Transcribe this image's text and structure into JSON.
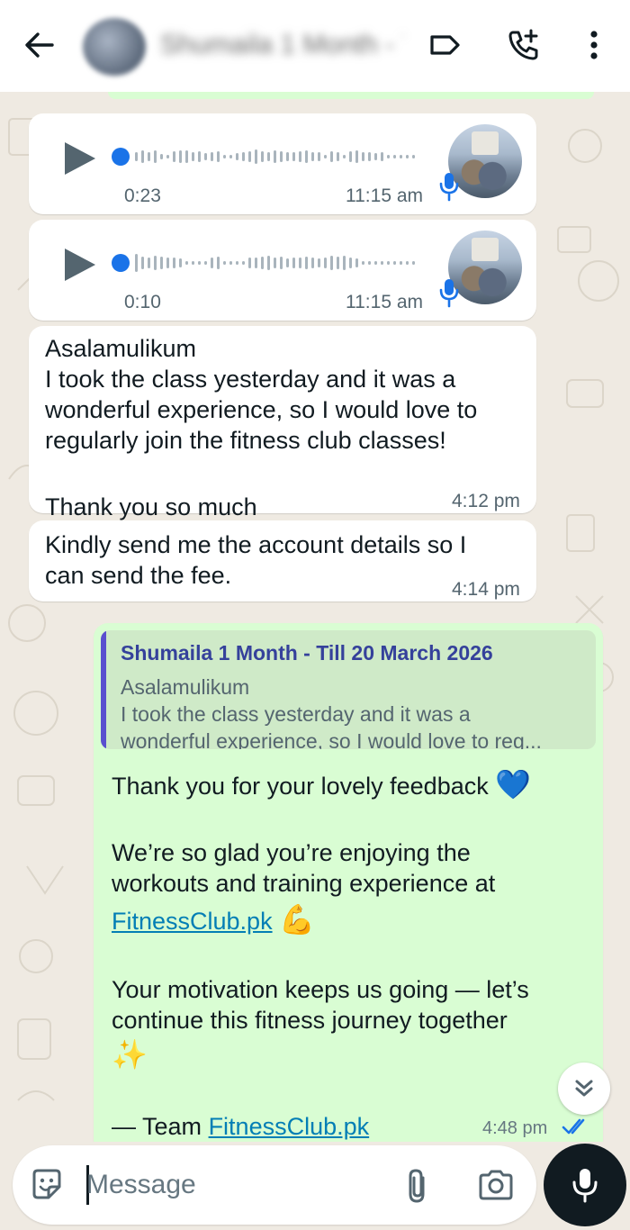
{
  "header": {
    "contact_name": "Shumaila 1 Month - Till 20 March 2026",
    "icons": [
      "back-arrow-icon",
      "label-icon",
      "add-call-icon",
      "more-vertical-icon"
    ]
  },
  "messages": {
    "voice": [
      {
        "duration": "0:23",
        "time": "11:15 am",
        "progress": 0
      },
      {
        "duration": "0:10",
        "time": "11:15 am",
        "progress": 0
      }
    ],
    "incoming_1": {
      "text": "Asalamulikum\nI took the class yesterday and it was a\nwonderful experience, so I would love to\nregularly join the fitness club classes!",
      "thanks": "Thank you so much",
      "emoji": "❤️",
      "time": "4:12 pm"
    },
    "incoming_2": {
      "text": "Kindly send me the account details so I\ncan send the fee.",
      "time": "4:14 pm"
    },
    "outgoing": {
      "quote_name": "Shumaila 1 Month - Till 20 March 2026",
      "quote_text": "Asalamulikum\nI took the class yesterday and it was a\nwonderful experience, so I would love to reg...",
      "line1": "Thank you for your lovely feedback",
      "line1_emoji": "💙",
      "line2a": "We’re so glad you’re enjoying the",
      "line2b": "workouts and training experience at",
      "link": "FitnessClub.pk",
      "link_emoji": "💪",
      "line3a": "Your motivation keeps us going — let’s",
      "line3b": "continue this fitness journey together",
      "line3_emoji": "✨",
      "sign_prefix": "— Team",
      "sign_link": "FitnessClub.pk",
      "time": "4:48 pm",
      "status": "read"
    }
  },
  "composer": {
    "placeholder": "Message"
  },
  "colors": {
    "incoming_bubble": "#ffffff",
    "outgoing_bubble": "#d9fdd3",
    "wallpaper": "#efeae2",
    "accent_blue": "#1a73e8",
    "quote_bar": "#5a4fcf"
  }
}
